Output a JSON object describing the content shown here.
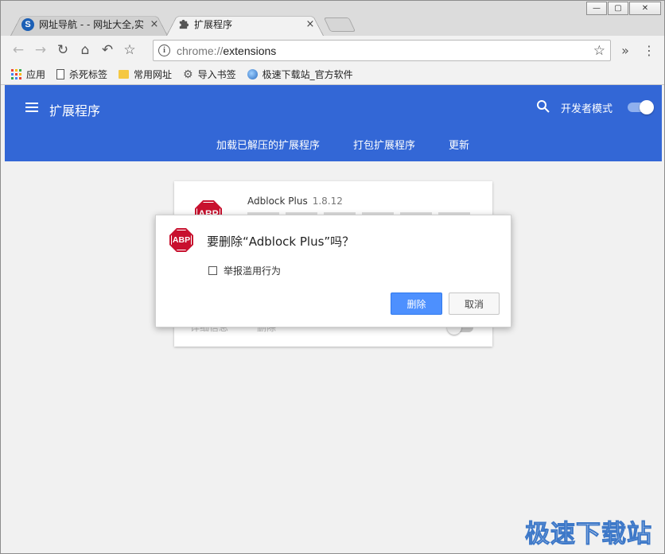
{
  "tabs": [
    {
      "title": "网址导航 - - 网址大全,实",
      "close": "×",
      "active": false,
      "favicon": "S"
    },
    {
      "title": "扩展程序",
      "close": "×",
      "active": true,
      "favicon": "puzzle-icon"
    }
  ],
  "window_controls": {
    "minimize": "—",
    "restore": "▢",
    "close": "✕"
  },
  "toolbar": {
    "back": "←",
    "forward": "→",
    "reload": "↻",
    "home": "⌂",
    "undo": "↶",
    "star": "☆",
    "url_scheme": "chrome://",
    "url_path": "extensions",
    "bookmark_star": "☆",
    "extension_menu": "»",
    "more": "⋮"
  },
  "bookmarks": [
    {
      "label": "应用",
      "icon": "apps-icon"
    },
    {
      "label": "杀死标签",
      "icon": "doc-icon"
    },
    {
      "label": "常用网址",
      "icon": "folder-icon"
    },
    {
      "label": "导入书签",
      "icon": "gear-icon"
    },
    {
      "label": "极速下载站_官方软件",
      "icon": "globe-icon"
    }
  ],
  "header": {
    "title": "扩展程序",
    "dev_mode_label": "开发者模式",
    "dev_mode_on": true,
    "actions": [
      "加载已解压的扩展程序",
      "打包扩展程序",
      "更新"
    ],
    "color": "#3367d6"
  },
  "extension_card": {
    "name": "Adblock Plus",
    "version": "1.8.12",
    "icon_text": "ABP",
    "details_label": "详细信息",
    "remove_label": "删除"
  },
  "dialog": {
    "icon_text": "ABP",
    "question": "要删除“Adblock Plus”吗？",
    "report_label": "举报滥用行为",
    "report_checked": false,
    "confirm_label": "删除",
    "cancel_label": "取消"
  },
  "watermark": "极速下载站"
}
